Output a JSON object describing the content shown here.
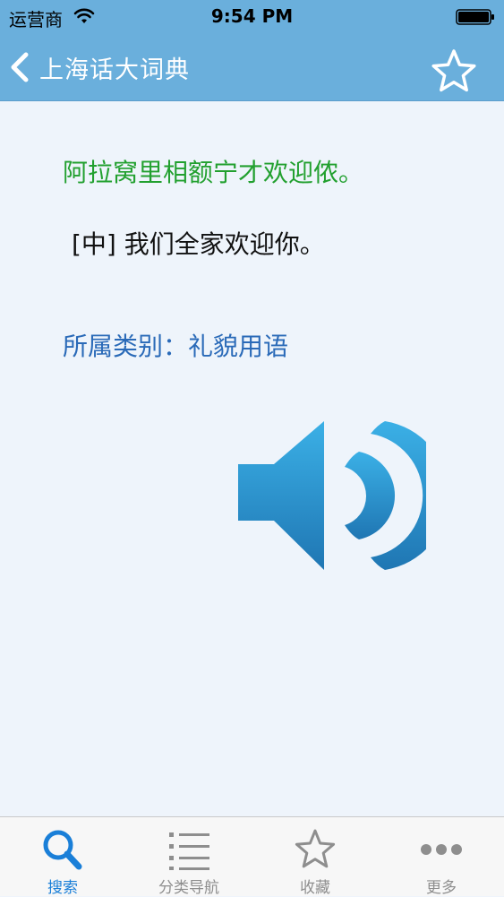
{
  "status_bar": {
    "carrier": "运营商",
    "time": "9:54 PM"
  },
  "nav": {
    "title": "上海话大词典"
  },
  "entry": {
    "dialect": "阿拉窝里相额宁才欢迎侬。",
    "mandarin": "[中] 我们全家欢迎你。",
    "category": "所属类别：礼貌用语"
  },
  "tabs": [
    {
      "label": "搜索",
      "icon": "search-icon",
      "active": true
    },
    {
      "label": "分类导航",
      "icon": "list-icon",
      "active": false
    },
    {
      "label": "收藏",
      "icon": "star-icon",
      "active": false
    },
    {
      "label": "更多",
      "icon": "more-icon",
      "active": false
    }
  ],
  "colors": {
    "bar": "#6aafdc",
    "dialect_text": "#22a02f",
    "category_text": "#2a6ab8",
    "active_tab": "#1a7fd8",
    "inactive_tab": "#8e8e8e"
  }
}
